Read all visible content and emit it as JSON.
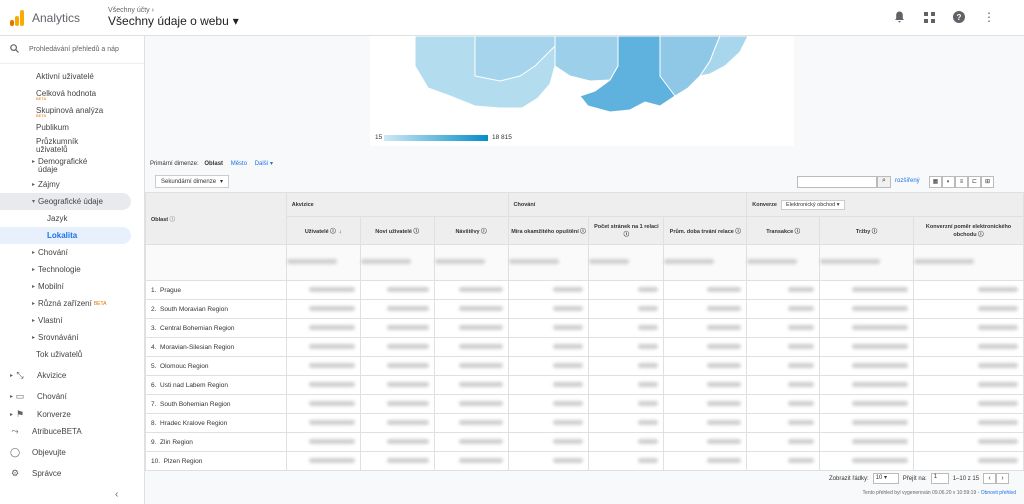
{
  "header": {
    "app": "Analytics",
    "crumb": "Všechny účty",
    "property": "Všechny údaje o webu"
  },
  "sidebar": {
    "search_placeholder": "Prohledávání přehledů a náp",
    "items": [
      {
        "label": "Aktivní uživatelé"
      },
      {
        "label": "Celková hodnota",
        "beta": "BETA"
      },
      {
        "label": "Skupinová analýza",
        "beta": "BETA"
      },
      {
        "label": "Publikum"
      },
      {
        "label": "Průzkumník uživatelů"
      },
      {
        "label": "Demografické údaje"
      },
      {
        "label": "Zájmy"
      },
      {
        "label": "Geografické údaje"
      },
      {
        "label": "Jazyk"
      },
      {
        "label": "Lokalita"
      },
      {
        "label": "Chování"
      },
      {
        "label": "Technologie"
      },
      {
        "label": "Mobilní"
      },
      {
        "label": "Různá zařízení",
        "beta": "BETA"
      },
      {
        "label": "Vlastní"
      },
      {
        "label": "Srovnávání"
      },
      {
        "label": "Tok uživatelů"
      }
    ],
    "sections": [
      {
        "label": "Akvizice",
        "icon": "acquisition-icon"
      },
      {
        "label": "Chování",
        "icon": "behavior-icon"
      },
      {
        "label": "Konverze",
        "icon": "flag-icon"
      },
      {
        "label": "Atribuce",
        "icon": "attribution-icon",
        "beta": "BETA"
      },
      {
        "label": "Objevujte",
        "icon": "lightbulb-icon"
      },
      {
        "label": "Správce",
        "icon": "gear-icon"
      }
    ]
  },
  "map": {
    "legend_min": "15",
    "legend_max": "18 815",
    "color_low": "#b3dcef",
    "color_high": "#058dc7"
  },
  "dimension": {
    "label": "Primární dimenze:",
    "current": "Oblast",
    "other": "Město",
    "more": "Další"
  },
  "toolbar": {
    "secondary": "Sekundární dimenze",
    "advanced": "rozšířený"
  },
  "table": {
    "dim_header": "Oblast",
    "groups": {
      "acq": "Akvizice",
      "beh": "Chování",
      "conv": "Konverze",
      "conv_select": "Elektronický obchod"
    },
    "columns": [
      "Uživatelé",
      "Noví uživatelé",
      "Návštěvy",
      "Míra okamžitého opuštění",
      "Počet stránek na 1 relaci",
      "Prům. doba trvání relace",
      "Transakce",
      "Tržby",
      "Konverzní poměr elektronického obchodu"
    ],
    "rows": [
      {
        "n": "1.",
        "name": "Prague"
      },
      {
        "n": "2.",
        "name": "South Moravian Region"
      },
      {
        "n": "3.",
        "name": "Central Bohemian Region"
      },
      {
        "n": "4.",
        "name": "Moravian-Silesian Region"
      },
      {
        "n": "5.",
        "name": "Olomouc Region"
      },
      {
        "n": "6.",
        "name": "Usti nad Labem Region"
      },
      {
        "n": "7.",
        "name": "South Bohemian Region"
      },
      {
        "n": "8.",
        "name": "Hradec Kralove Region"
      },
      {
        "n": "9.",
        "name": "Zlin Region"
      },
      {
        "n": "10.",
        "name": "Plzen Region"
      }
    ]
  },
  "footer": {
    "rows_label": "Zobrazit řádky:",
    "rows_value": "10",
    "goto_label": "Přejít na:",
    "goto_value": "1",
    "range": "1–10 z 15",
    "generated": "Tento přehled byl vygenerován 09.06.20 v 10:59:19 -",
    "refresh": "Obnovit přehled"
  }
}
